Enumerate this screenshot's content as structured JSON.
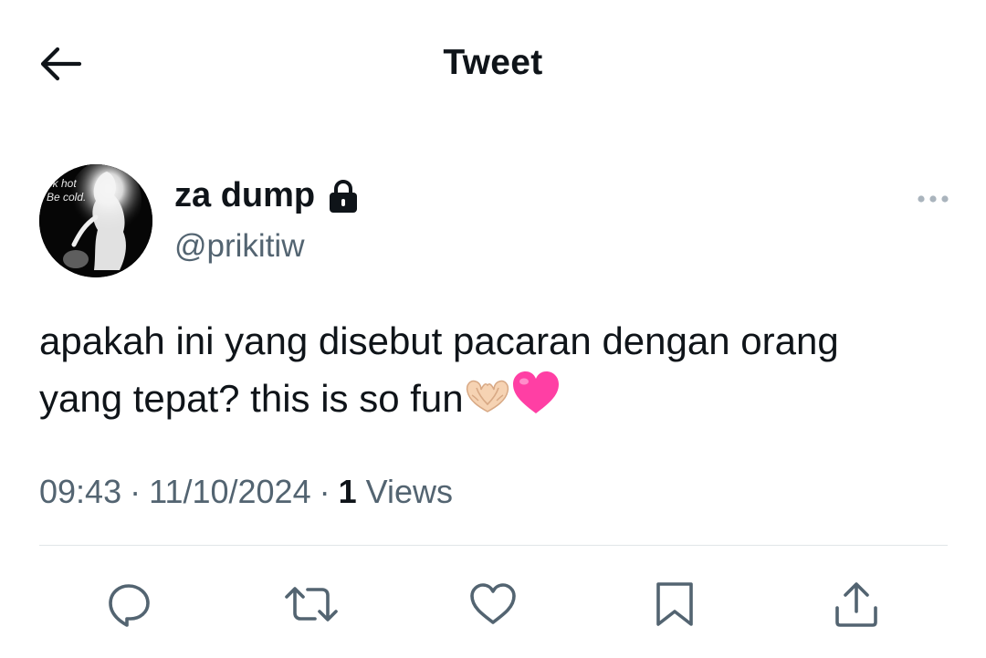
{
  "header": {
    "title": "Tweet"
  },
  "tweet": {
    "author": {
      "name": "za dump",
      "handle": "@prikitiw",
      "avatar_text": "ok hot\nBe cold."
    },
    "text_line1": "apakah ini yang disebut pacaran dengan orang",
    "text_line2": "yang tepat? this is so fun",
    "emojis": [
      "heart-hands-emoji",
      "pink-heart-emoji"
    ],
    "time": "09:43",
    "date": "11/10/2024",
    "separator": "·",
    "views_count": "1",
    "views_label": "Views"
  },
  "actions": [
    "reply-icon",
    "retweet-icon",
    "like-icon",
    "bookmark-icon",
    "share-icon"
  ],
  "colors": {
    "text_primary": "#0f1419",
    "text_secondary": "#536471",
    "icon": "#536471",
    "divider": "#e1e5e8",
    "pink_heart": "#ff3fa4"
  }
}
